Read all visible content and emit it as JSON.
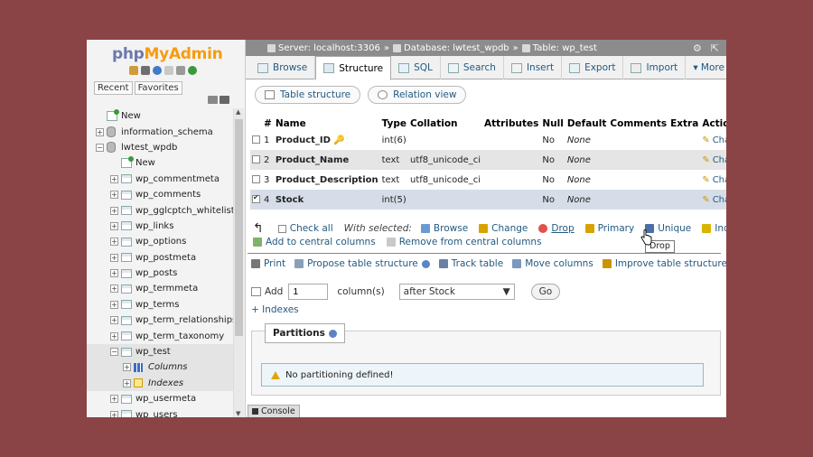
{
  "app": {
    "logo_php": "php",
    "logo_myadmin": "MyAdmin"
  },
  "nav": {
    "tabs": [
      "Recent",
      "Favorites"
    ],
    "tree": [
      {
        "label": "New",
        "level": 0,
        "kind": "new",
        "expander": ""
      },
      {
        "label": "information_schema",
        "level": 0,
        "kind": "db",
        "expander": "+"
      },
      {
        "label": "lwtest_wpdb",
        "level": 0,
        "kind": "db",
        "expander": "−"
      },
      {
        "label": "New",
        "level": 1,
        "kind": "new",
        "expander": ""
      },
      {
        "label": "wp_commentmeta",
        "level": 1,
        "kind": "table",
        "expander": "+"
      },
      {
        "label": "wp_comments",
        "level": 1,
        "kind": "table",
        "expander": "+"
      },
      {
        "label": "wp_gglcptch_whitelist",
        "level": 1,
        "kind": "table",
        "expander": "+"
      },
      {
        "label": "wp_links",
        "level": 1,
        "kind": "table",
        "expander": "+"
      },
      {
        "label": "wp_options",
        "level": 1,
        "kind": "table",
        "expander": "+"
      },
      {
        "label": "wp_postmeta",
        "level": 1,
        "kind": "table",
        "expander": "+"
      },
      {
        "label": "wp_posts",
        "level": 1,
        "kind": "table",
        "expander": "+"
      },
      {
        "label": "wp_termmeta",
        "level": 1,
        "kind": "table",
        "expander": "+"
      },
      {
        "label": "wp_terms",
        "level": 1,
        "kind": "table",
        "expander": "+"
      },
      {
        "label": "wp_term_relationships",
        "level": 1,
        "kind": "table",
        "expander": "+"
      },
      {
        "label": "wp_term_taxonomy",
        "level": 1,
        "kind": "table",
        "expander": "+"
      },
      {
        "label": "wp_test",
        "level": 1,
        "kind": "table",
        "expander": "−",
        "selected": true
      },
      {
        "label": "Columns",
        "level": 2,
        "kind": "columns",
        "expander": "+",
        "selected": true
      },
      {
        "label": "Indexes",
        "level": 2,
        "kind": "indexes",
        "expander": "+",
        "selected": true
      },
      {
        "label": "wp_usermeta",
        "level": 1,
        "kind": "table",
        "expander": "+"
      },
      {
        "label": "wp_users",
        "level": 1,
        "kind": "table",
        "expander": "+"
      }
    ]
  },
  "breadcrumb": {
    "server": "Server: localhost:3306",
    "database": "Database: lwtest_wpdb",
    "table": "Table: wp_test",
    "sep": "»"
  },
  "tabs": [
    {
      "label": "Browse",
      "active": false
    },
    {
      "label": "Structure",
      "active": true
    },
    {
      "label": "SQL",
      "active": false
    },
    {
      "label": "Search",
      "active": false
    },
    {
      "label": "Insert",
      "active": false
    },
    {
      "label": "Export",
      "active": false
    },
    {
      "label": "Import",
      "active": false
    },
    {
      "label": "▾ More",
      "active": false
    }
  ],
  "subtabs": [
    "Table structure",
    "Relation view"
  ],
  "structure": {
    "headers": [
      "#",
      "Name",
      "Type",
      "Collation",
      "Attributes",
      "Null",
      "Default",
      "Comments",
      "Extra",
      "Action"
    ],
    "rows": [
      {
        "num": "1",
        "name": "Product_ID",
        "key": true,
        "type": "int(6)",
        "collation": "",
        "null": "No",
        "default": "None",
        "action": "Change",
        "checked": false
      },
      {
        "num": "2",
        "name": "Product_Name",
        "key": false,
        "type": "text",
        "collation": "utf8_unicode_ci",
        "null": "No",
        "default": "None",
        "action": "Change",
        "checked": false
      },
      {
        "num": "3",
        "name": "Product_Description",
        "key": false,
        "type": "text",
        "collation": "utf8_unicode_ci",
        "null": "No",
        "default": "None",
        "action": "Change",
        "checked": false
      },
      {
        "num": "4",
        "name": "Stock",
        "key": false,
        "type": "int(5)",
        "collation": "",
        "null": "No",
        "default": "None",
        "action": "Change",
        "checked": true
      }
    ],
    "drop_stub": "D"
  },
  "with_selected": {
    "check_all": "Check all",
    "label": "With selected:",
    "actions": [
      "Browse",
      "Change",
      "Drop",
      "Primary",
      "Unique",
      "Index"
    ],
    "second_row": [
      "Add to central columns",
      "Remove from central columns"
    ],
    "tooltip": "Drop"
  },
  "tools": [
    "Print",
    "Propose table structure",
    "Track table",
    "Move columns",
    "Improve table structure"
  ],
  "add_columns": {
    "add_label": "Add",
    "count": "1",
    "columns_label": "column(s)",
    "position": "after Stock",
    "go": "Go"
  },
  "indexes_link": "+ Indexes",
  "partitions": {
    "legend": "Partitions",
    "notice": "No partitioning defined!"
  },
  "console": "Console",
  "colors": {
    "background": "#8a4446",
    "link": "#235a81",
    "logo_php": "#6c78af",
    "logo_myadmin": "#f89c0e"
  }
}
